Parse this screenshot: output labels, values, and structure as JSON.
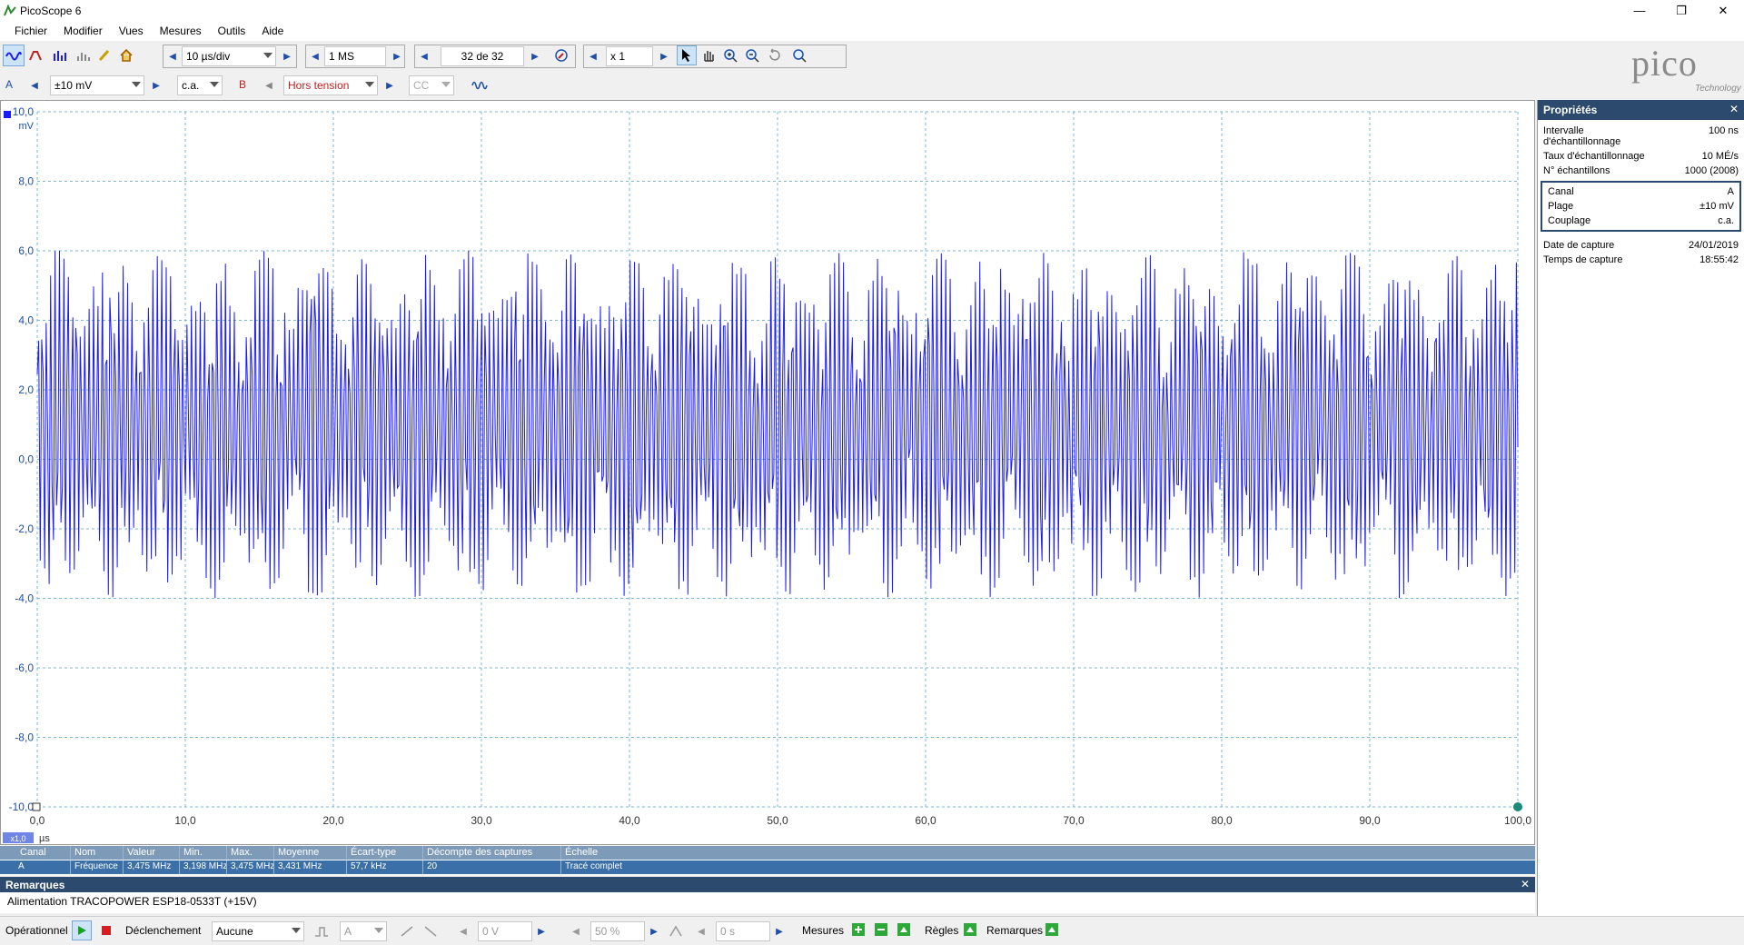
{
  "window": {
    "title": "PicoScope 6"
  },
  "menu": [
    "Fichier",
    "Modifier",
    "Vues",
    "Mesures",
    "Outils",
    "Aide"
  ],
  "toolbar": {
    "timebase": "10 µs/div",
    "samples": "1 MS",
    "capture": "32 de 32",
    "zoom": "x 1"
  },
  "channel_bar": {
    "channel_a_label": "A",
    "range": "±10 mV",
    "coupling": "c.a.",
    "channel_b_label": "B",
    "channel_b_state": "Hors tension",
    "channel_b_coupling": "CC"
  },
  "logo": {
    "text": "pico",
    "subtext": "Technology"
  },
  "colors": {
    "trace": "#1a1aff",
    "grid": "#7ab8d8",
    "header": "#2c4a6e",
    "accent": "#3b6fa8"
  },
  "chart_data": {
    "type": "line",
    "xlabel": "µs",
    "ylabel": "mV",
    "xlim": [
      0,
      100
    ],
    "ylim": [
      -10,
      10
    ],
    "x_ticks": [
      "0,0",
      "10,0",
      "20,0",
      "30,0",
      "40,0",
      "50,0",
      "60,0",
      "70,0",
      "80,0",
      "90,0",
      "100,0"
    ],
    "y_ticks": [
      "10,0",
      "8,0",
      "6,0",
      "4,0",
      "2,0",
      "0,0",
      "-2,0",
      "-4,0",
      "-6,0",
      "-8,0",
      "-10,0"
    ],
    "x_zoom_label": "x1,0",
    "grid": true,
    "series": [
      {
        "frequency_mhz": 3.475,
        "mean_mv": 1.0,
        "amplitude_mv": 5.0,
        "min_mv": -4.1,
        "max_mv": 6.0
      }
    ]
  },
  "properties": {
    "title": "Propriétés",
    "rows": [
      {
        "k": "Intervalle d'échantillonnage",
        "v": "100 ns"
      },
      {
        "k": "Taux d'échantillonnage",
        "v": "10 MÉ/s"
      },
      {
        "k": "N° échantillons",
        "v": "1000  (2008)"
      }
    ],
    "channel_box": [
      {
        "k": "Canal",
        "v": "A"
      },
      {
        "k": "Plage",
        "v": "±10 mV"
      },
      {
        "k": "Couplage",
        "v": "c.a."
      }
    ],
    "capture": [
      {
        "k": "Date de capture",
        "v": "24/01/2019"
      },
      {
        "k": "Temps de capture",
        "v": "18:55:42"
      }
    ]
  },
  "measurements": {
    "headers": [
      "Canal",
      "Nom",
      "Valeur",
      "Min.",
      "Max.",
      "Moyenne",
      "Écart-type",
      "Décompte des captures",
      "Échelle"
    ],
    "row": [
      "A",
      "Fréquence",
      "3,475 MHz",
      "3,198 MHz",
      "3,475 MHz",
      "3,431 MHz",
      "57,7 kHz",
      "20",
      "Tracé complet"
    ]
  },
  "notes": {
    "title": "Remarques",
    "text": "Alimentation TRACOPOWER ESP18-0533T (+15V)"
  },
  "bottom": {
    "mode": "Opérationnel",
    "trigger_label": "Déclenchement",
    "trigger_value": "Aucune",
    "trigger_channel": "A",
    "trigger_level": "0 V",
    "pretrigger": "50 %",
    "delay": "0 s",
    "measures": "Mesures",
    "rules": "Règles",
    "notes": "Remarques"
  }
}
